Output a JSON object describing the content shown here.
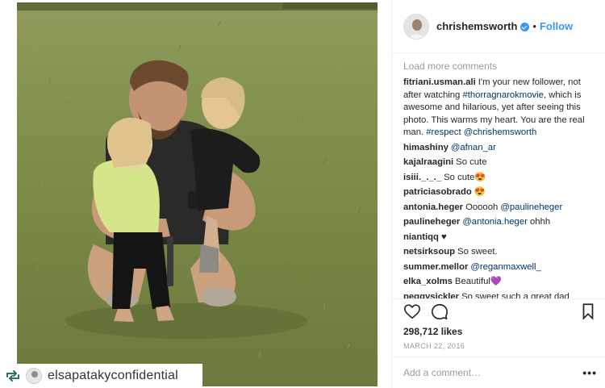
{
  "repost": {
    "icon": "repost-icon",
    "account": "elsapatakyconfidential"
  },
  "post": {
    "author": "chrishemsworth",
    "verified": true,
    "separator": "•",
    "follow_label": "Follow",
    "load_more_label": "Load more comments",
    "comments": [
      {
        "user": "fitriani.usman.ali",
        "parts": [
          {
            "t": "I'm your new follower, not after watching "
          },
          {
            "t": "#thorragnarokmovie",
            "m": true
          },
          {
            "t": ", which is awesome and hilarious, yet after seeing this photo. This warms my heart. You are the real man. "
          },
          {
            "t": "#respect",
            "m": true
          },
          {
            "t": " "
          },
          {
            "t": "@chrishemsworth",
            "m": true
          }
        ]
      },
      {
        "user": "himashiny",
        "parts": [
          {
            "t": "@afnan_ar",
            "m": true
          }
        ]
      },
      {
        "user": "kajalraagini",
        "parts": [
          {
            "t": "So cute"
          }
        ]
      },
      {
        "user": "isiii._._._",
        "parts": [
          {
            "t": "So cute😍"
          }
        ]
      },
      {
        "user": "patriciasobrado",
        "parts": [
          {
            "t": "😍"
          }
        ]
      },
      {
        "user": "antonia.heger",
        "parts": [
          {
            "t": "Oooooh "
          },
          {
            "t": "@paulineheger",
            "m": true
          }
        ]
      },
      {
        "user": "paulineheger",
        "parts": [
          {
            "t": "@antonia.heger",
            "m": true
          },
          {
            "t": " ohhh"
          }
        ]
      },
      {
        "user": "niantiqq",
        "parts": [
          {
            "t": "♥"
          }
        ]
      },
      {
        "user": "netsirksoup",
        "parts": [
          {
            "t": "So sweet."
          }
        ]
      },
      {
        "user": "summer.mellor",
        "parts": [
          {
            "t": "@reganmaxwell_",
            "m": true
          }
        ]
      },
      {
        "user": "elka_xolms",
        "parts": [
          {
            "t": "Beautiful💜"
          }
        ]
      },
      {
        "user": "peggysickler",
        "parts": [
          {
            "t": "So sweet such a great dad"
          }
        ]
      }
    ],
    "likes": "298,712 likes",
    "date": "MARCH 22, 2016",
    "add_comment_placeholder": "Add a comment…",
    "more_options_label": "•••",
    "icons": [
      "heart-icon",
      "comment-icon",
      "bookmark-icon"
    ]
  },
  "colors": {
    "link": "#3897f0",
    "mention": "#003569",
    "muted": "#999999",
    "grass": "#7f8e4c"
  }
}
